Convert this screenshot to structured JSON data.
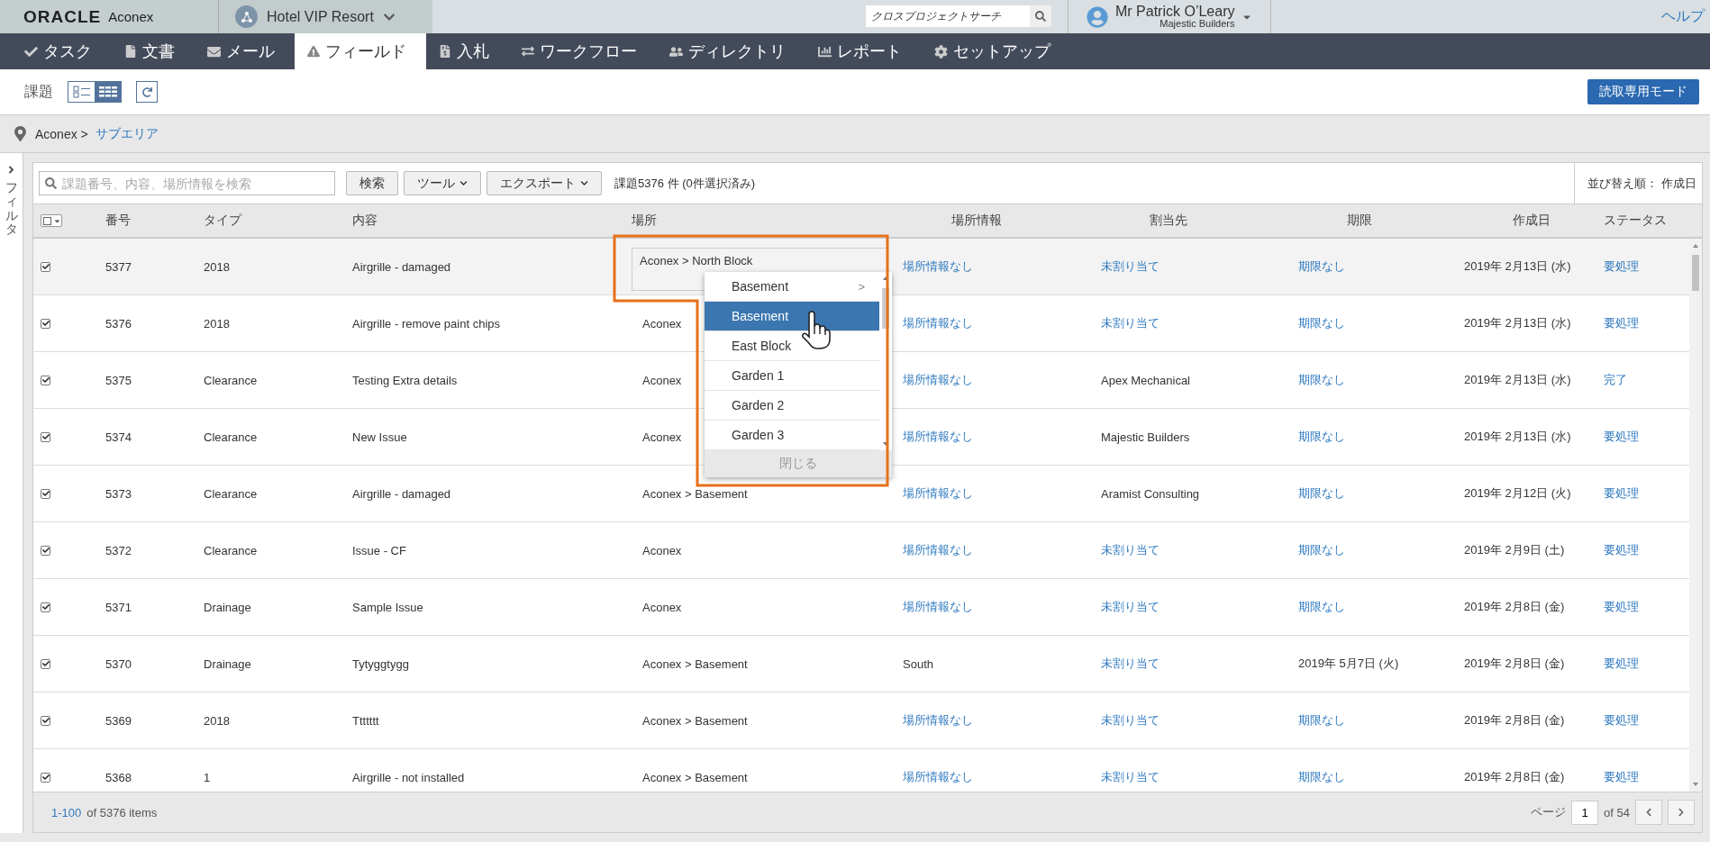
{
  "header": {
    "logo": "ORACLE",
    "product": "Aconex",
    "project": "Hotel VIP Resort",
    "search_placeholder": "クロスプロジェクトサーチ",
    "user_name": "Mr Patrick O’Leary",
    "user_org": "Majestic Builders",
    "help": "ヘルプ"
  },
  "nav": [
    {
      "label": "タスク",
      "kind": "check",
      "selected": false
    },
    {
      "label": "文書",
      "kind": "document",
      "selected": false
    },
    {
      "label": "メール",
      "kind": "mail",
      "selected": false
    },
    {
      "label": "フィールド",
      "kind": "warning",
      "selected": true
    },
    {
      "label": "入札",
      "kind": "bid",
      "selected": false
    },
    {
      "label": "ワークフロー",
      "kind": "workflow",
      "selected": false
    },
    {
      "label": "ディレクトリ",
      "kind": "people",
      "selected": false
    },
    {
      "label": "レポート",
      "kind": "chart",
      "selected": false
    },
    {
      "label": "セットアップ",
      "kind": "gear",
      "selected": false
    }
  ],
  "toolbar": {
    "title": "課題",
    "views": [
      {
        "kind": "list",
        "selected": false
      },
      {
        "kind": "grid",
        "selected": true
      }
    ],
    "read_only_button": "読取専用モード"
  },
  "breadcrumb": {
    "root": "Aconex >",
    "current": "サブエリア"
  },
  "filter_tab": {
    "label": "フィルタ"
  },
  "search": {
    "placeholder": "課題番号、内容、場所情報を検索",
    "search_button": "検索",
    "tools_button": "ツール",
    "export_button": "エクスポート",
    "count": "課題5376 件 (0件選択済み)",
    "sort": "並び替え順： 作成日"
  },
  "table": {
    "select_all_checked": false,
    "columns": [
      "番号",
      "タイプ",
      "内容",
      "場所",
      "場所情報",
      "割当先",
      "期限",
      "作成日",
      "ステータス"
    ],
    "rows": [
      {
        "checked": true,
        "editing": true,
        "number": "5377",
        "type": "2018",
        "content": "Airgrille - damaged",
        "location": "Aconex > North Block",
        "location_info": {
          "text": "場所情報なし",
          "link": true
        },
        "assignee": {
          "text": "未割り当て",
          "link": true
        },
        "due": {
          "text": "期限なし",
          "link": true
        },
        "created": "2019年 2月13日 (水)",
        "status": "要処理"
      },
      {
        "checked": true,
        "editing": false,
        "number": "5376",
        "type": "2018",
        "content": "Airgrille - remove paint chips",
        "location": "Aconex",
        "location_info": {
          "text": "場所情報なし",
          "link": true
        },
        "assignee": {
          "text": "未割り当て",
          "link": true
        },
        "due": {
          "text": "期限なし",
          "link": true
        },
        "created": "2019年 2月13日 (水)",
        "status": "要処理"
      },
      {
        "checked": true,
        "editing": false,
        "number": "5375",
        "type": "Clearance",
        "content": "Testing Extra details",
        "location": "Aconex",
        "location_info": {
          "text": "場所情報なし",
          "link": true
        },
        "assignee": {
          "text": "Apex Mechanical",
          "link": false
        },
        "due": {
          "text": "期限なし",
          "link": true
        },
        "created": "2019年 2月13日 (水)",
        "status": "完了"
      },
      {
        "checked": true,
        "editing": false,
        "number": "5374",
        "type": "Clearance",
        "content": "New Issue",
        "location": "Aconex",
        "location_info": {
          "text": "場所情報なし",
          "link": true
        },
        "assignee": {
          "text": "Majestic Builders",
          "link": false
        },
        "due": {
          "text": "期限なし",
          "link": true
        },
        "created": "2019年 2月13日 (水)",
        "status": "要処理"
      },
      {
        "checked": true,
        "editing": false,
        "number": "5373",
        "type": "Clearance",
        "content": "Airgrille - damaged",
        "location": "Aconex > Basement",
        "location_info": {
          "text": "場所情報なし",
          "link": true
        },
        "assignee": {
          "text": "Aramist Consulting",
          "link": false
        },
        "due": {
          "text": "期限なし",
          "link": true
        },
        "created": "2019年 2月12日 (火)",
        "status": "要処理"
      },
      {
        "checked": true,
        "editing": false,
        "number": "5372",
        "type": "Clearance",
        "content": "Issue - CF",
        "location": "Aconex",
        "location_info": {
          "text": "場所情報なし",
          "link": true
        },
        "assignee": {
          "text": "未割り当て",
          "link": true
        },
        "due": {
          "text": "期限なし",
          "link": true
        },
        "created": "2019年 2月9日 (土)",
        "status": "要処理"
      },
      {
        "checked": true,
        "editing": false,
        "number": "5371",
        "type": "Drainage",
        "content": "Sample Issue",
        "location": "Aconex",
        "location_info": {
          "text": "場所情報なし",
          "link": true
        },
        "assignee": {
          "text": "未割り当て",
          "link": true
        },
        "due": {
          "text": "期限なし",
          "link": true
        },
        "created": "2019年 2月8日 (金)",
        "status": "要処理"
      },
      {
        "checked": true,
        "editing": false,
        "number": "5370",
        "type": "Drainage",
        "content": "Tytyggtygg",
        "location": "Aconex > Basement",
        "location_info": {
          "text": "South",
          "link": false
        },
        "assignee": {
          "text": "未割り当て",
          "link": true
        },
        "due": {
          "text": "2019年 5月7日 (火)",
          "link": false
        },
        "created": "2019年 2月8日 (金)",
        "status": "要処理"
      },
      {
        "checked": true,
        "editing": false,
        "number": "5369",
        "type": "2018",
        "content": "Ttttttt",
        "location": "Aconex > Basement",
        "location_info": {
          "text": "場所情報なし",
          "link": true
        },
        "assignee": {
          "text": "未割り当て",
          "link": true
        },
        "due": {
          "text": "期限なし",
          "link": true
        },
        "created": "2019年 2月8日 (金)",
        "status": "要処理"
      },
      {
        "checked": true,
        "editing": false,
        "number": "5368",
        "type": "1",
        "content": "Airgrille - not installed",
        "location": "Aconex > Basement",
        "location_info": {
          "text": "場所情報なし",
          "link": true
        },
        "assignee": {
          "text": "未割り当て",
          "link": true
        },
        "due": {
          "text": "期限なし",
          "link": true
        },
        "created": "2019年 2月8日 (金)",
        "status": "要処理"
      }
    ]
  },
  "location_picker": {
    "options": [
      {
        "label": "Basement",
        "selected": false,
        "child_marker": ">"
      },
      {
        "label": "Basement",
        "selected": true
      },
      {
        "label": "East Block",
        "selected": false
      },
      {
        "label": "Garden 1",
        "selected": false
      },
      {
        "label": "Garden 2",
        "selected": false
      },
      {
        "label": "Garden 3",
        "selected": false
      }
    ],
    "close_label": "閉じる"
  },
  "footer": {
    "range": "1-100",
    "total": "of 5376 items",
    "page_label": "ページ",
    "page": "1",
    "page_count": "of 54"
  }
}
